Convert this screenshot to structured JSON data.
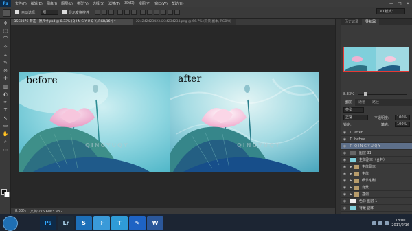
{
  "app": {
    "logo": "Ps"
  },
  "menu": [
    "文件(F)",
    "编辑(E)",
    "图像(I)",
    "图层(L)",
    "类型(Y)",
    "选择(S)",
    "滤镜(T)",
    "3D(D)",
    "视图(V)",
    "窗口(W)",
    "帮助(H)"
  ],
  "window_buttons": {
    "minimize": "—",
    "maximize": "□",
    "close": "✕"
  },
  "options": {
    "auto_select_label": "自动选择：",
    "auto_select_value": "组",
    "show_transform_label": "显示变换控件",
    "workspace": "3D 模式："
  },
  "tabs": [
    {
      "label": "DSC0376-荷花 - 原尺寸.psd @ 8.33% (Q I N G Y U Q Y, RGB/16*) *",
      "active": true
    },
    {
      "label": "2242424234234234234234.png @ 66.7% (背景 副本, RGB/8)",
      "active": false
    }
  ],
  "tools": [
    "✥",
    "⬚",
    "⌒",
    "✧",
    "⌗",
    "✎",
    "⊘",
    "✚",
    "▥",
    "◐",
    "✒",
    "T",
    "↖",
    "▭",
    "✋",
    "⌕",
    "⋯"
  ],
  "canvas": {
    "caption_before": "before",
    "caption_after": "after",
    "watermark": "QINGYUQY"
  },
  "statusbar": {
    "zoom": "8.33%",
    "doc": "文档:275.6M/3.98G"
  },
  "panel": {
    "tabs": [
      "历史记录",
      "导航器"
    ],
    "active_tab": "导航器",
    "zoom": "8.33%",
    "layers_tabs": [
      "图层",
      "通道",
      "路径"
    ],
    "kind_filter": "类型",
    "blend_mode": "正常",
    "opacity_label": "不透明度:",
    "opacity": "100%",
    "lock_label": "锁定:",
    "fill_label": "填充:",
    "fill": "100%"
  },
  "layers": [
    {
      "name": "after",
      "type": "text"
    },
    {
      "name": "before",
      "type": "text"
    },
    {
      "name": "Q I N G Y U Q Y",
      "type": "text",
      "selected": true
    },
    {
      "name": "图层 31",
      "type": "image"
    },
    {
      "name": "主体副本（合并）",
      "type": "image"
    },
    {
      "name": "主体副本",
      "type": "group"
    },
    {
      "name": "主体",
      "type": "group"
    },
    {
      "name": "细节笔刷",
      "type": "group"
    },
    {
      "name": "背景",
      "type": "group"
    },
    {
      "name": "基调",
      "type": "group"
    },
    {
      "name": "色彩 图层 1",
      "type": "image"
    },
    {
      "name": "背景 副本",
      "type": "image"
    }
  ],
  "taskbar": {
    "apps": [
      {
        "label": "Ps",
        "bg": "#0e2a47",
        "fg": "#31a8ff"
      },
      {
        "label": "Lr",
        "bg": "#1c2b3a",
        "fg": "#add5ec"
      },
      {
        "label": "S",
        "bg": "#1d6fb8",
        "fg": "#ffffff"
      },
      {
        "label": "✈",
        "bg": "#3a9ad9",
        "fg": "#ffffff"
      },
      {
        "label": "T",
        "bg": "#2f9bd6",
        "fg": "#ffffff"
      },
      {
        "label": "✎",
        "bg": "#1e63c4",
        "fg": "#ffffff"
      },
      {
        "label": "W",
        "bg": "#2b579a",
        "fg": "#ffffff"
      }
    ],
    "time": "18:00",
    "date": "2017/2/16"
  },
  "colors": {
    "accent": "#5d6f8a",
    "nav_frame": "#e53935"
  }
}
